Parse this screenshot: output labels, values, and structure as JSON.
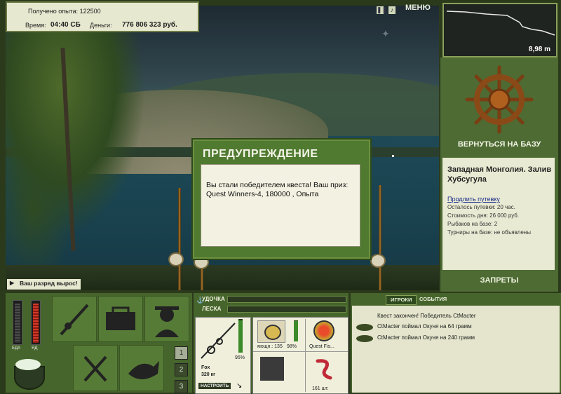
{
  "info": {
    "exp_label": "Получено опыта: 122500",
    "time_label": "Время:",
    "time_value": "04:40 СБ",
    "money_label": "Деньги:",
    "money_value": "776 806 323 руб."
  },
  "toolbar": {
    "menu_label": "МЕНЮ"
  },
  "depth": {
    "value": "8,98 m"
  },
  "right": {
    "return_label": "ВЕРНУТЬСЯ НА БАЗУ",
    "location": "Западная Монголия. Залив Хубсугула",
    "extend_link": "Продлить путевку",
    "lines": [
      "Осталось путевки: 20 час.",
      "Стоимость дня: 26 000 руб.",
      "Рыбаков на базе: 2",
      "Турниры на базе: не объявлены"
    ],
    "bans_label": "ЗАПРЕТЫ"
  },
  "dialog": {
    "title": "ПРЕДУПРЕЖДЕНИЕ",
    "message": "Вы стали победителем квеста! Ваш приз: Quest Winners-4, 180000 , Опыта"
  },
  "notify": {
    "text": "Ваш разряд вырос!"
  },
  "status": {
    "food_label": "ЕДА",
    "poison_label": "ЯД",
    "slots": [
      "1",
      "2",
      "3"
    ]
  },
  "tackle": {
    "rod_label": "УДОЧКА",
    "line_label": "ЛЕСКА",
    "rod_name": "Fox",
    "rod_weight": "320 кг",
    "rod_percent": "95%",
    "configure_label": "НАСТРОИТЬ",
    "reel_power": "мощн.: 135",
    "reel_percent": "98%",
    "line_name": "Quest Fis...",
    "bait_count": "161 шт."
  },
  "chat": {
    "tab_players": "ИГРОКИ",
    "tab_events": "СОБЫТИЯ",
    "messages": [
      "Квест закончен! Победитель CtMacter",
      "CtMacter поймал Окуня на 64 грамм",
      "CtMacter поймал Окуня на 240 грамм"
    ]
  }
}
